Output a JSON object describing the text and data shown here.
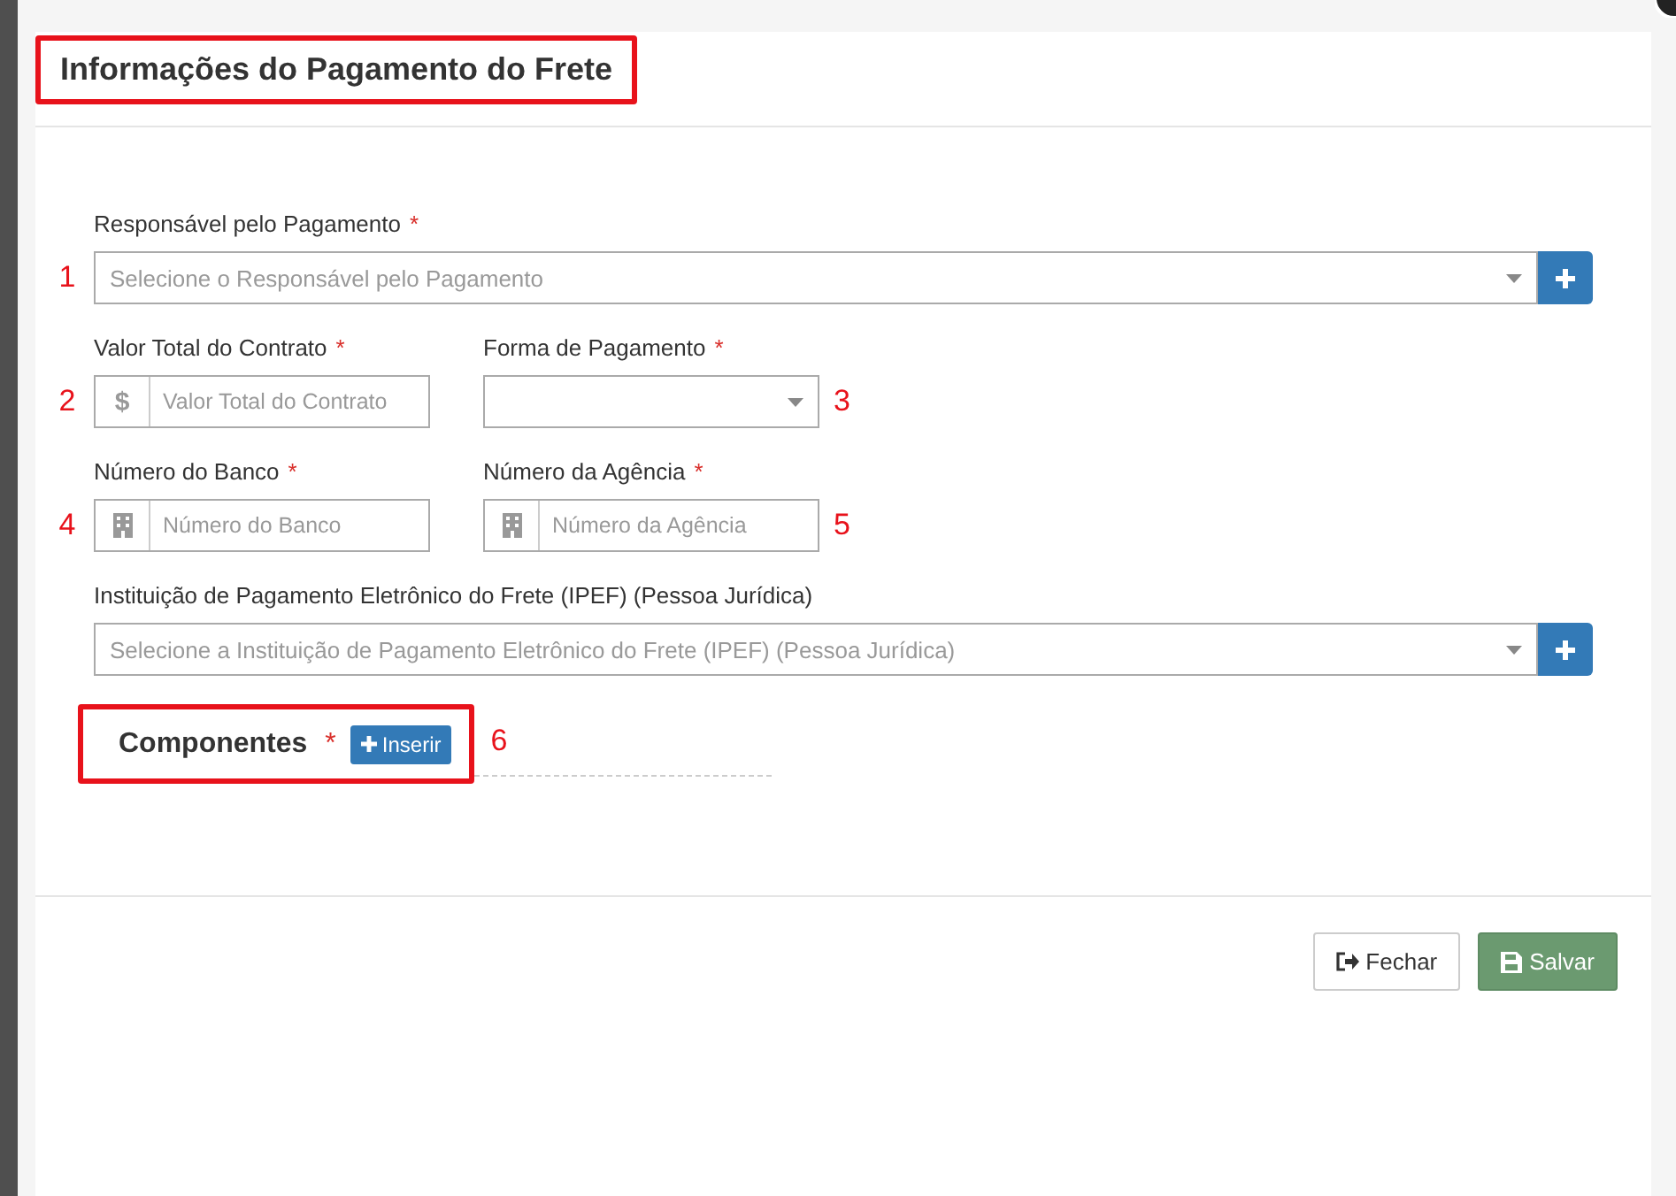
{
  "title": {
    "text": "Informações do Pagamento do Frete",
    "highlighted": true
  },
  "rows": [
    {
      "fields": [
        {
          "kind": "select",
          "label": "Responsável pelo Pagamento",
          "required_mark": "*",
          "placeholder": "Selecione o Responsável pelo Pagamento",
          "callout_before": "1"
        }
      ]
    },
    {
      "fields": [
        {
          "kind": "prefix_input",
          "label": "Valor Total do Contrato",
          "required_mark": "*",
          "prefix": "$",
          "placeholder": "Valor Total do Contrato",
          "callout_before": "2"
        },
        {
          "kind": "dropdown",
          "label": "Forma de Pagamento",
          "required_mark": "*",
          "callout_after": "3"
        }
      ]
    },
    {
      "fields": [
        {
          "kind": "icon_input",
          "label": "Número do Banco",
          "required_mark": "*",
          "placeholder": "Número do Banco",
          "callout_before": "4"
        },
        {
          "kind": "icon_input",
          "label": "Número da Agência",
          "required_mark": "*",
          "placeholder": "Número da Agência",
          "callout_after": "5"
        }
      ]
    },
    {
      "fields": [
        {
          "kind": "select",
          "label": "Instituição de Pagamento Eletrônico do Frete (IPEF) (Pessoa Jurídica)",
          "placeholder": "Selecione a Instituição de Pagamento Eletrônico do Frete (IPEF) (Pessoa Jurídica)"
        }
      ]
    }
  ],
  "components": {
    "title": "Componentes",
    "required_mark": "*",
    "button": "Inserir",
    "highlighted": true,
    "callout": "6"
  },
  "footer": {
    "buttons": [
      {
        "kind": "close",
        "label": "Fechar"
      },
      {
        "kind": "save",
        "label": "Salvar"
      }
    ]
  }
}
